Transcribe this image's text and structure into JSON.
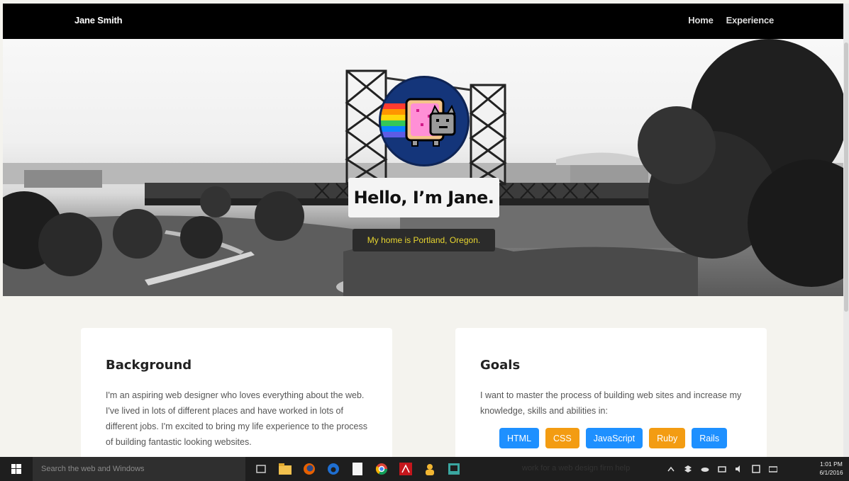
{
  "navbar": {
    "brand": "Jane Smith",
    "links": [
      "Home",
      "Experience"
    ]
  },
  "hero": {
    "title": "Hello, I’m Jane.",
    "subtitle": "My home is Portland, Oregon.",
    "subtitle_color": "#e8d630"
  },
  "background": {
    "heading": "Background",
    "text": "I'm an aspiring web designer who loves everything about the web. I've lived in lots of different places and have worked in lots of different jobs. I'm excited to bring my life experience to the process of building fantastic looking websites."
  },
  "goals": {
    "heading": "Goals",
    "text": "I want to master the process of building web sites and increase my knowledge, skills and abilities in:",
    "skills": [
      {
        "label": "HTML",
        "color": "#1e90ff"
      },
      {
        "label": "CSS",
        "color": "#f39c12"
      },
      {
        "label": "JavaScript",
        "color": "#1e90ff"
      },
      {
        "label": "Ruby",
        "color": "#f39c12"
      },
      {
        "label": "Rails",
        "color": "#1e90ff"
      }
    ]
  },
  "taskbar": {
    "search_placeholder": "Search the web and Windows",
    "overlay_text": "work for a web design firm help",
    "clock_time": "1:01 PM",
    "clock_date": "6/1/2016"
  }
}
